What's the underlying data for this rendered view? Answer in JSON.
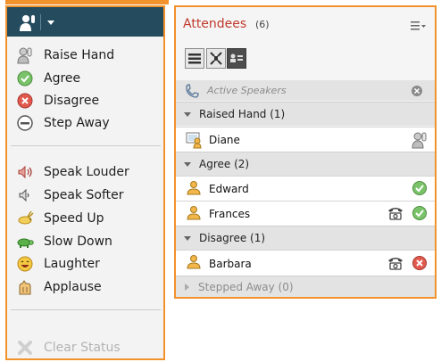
{
  "status_menu": {
    "items": [
      {
        "label": "Raise Hand",
        "icon": "raise-hand-icon"
      },
      {
        "label": "Agree",
        "icon": "agree-check-icon"
      },
      {
        "label": "Disagree",
        "icon": "disagree-x-icon"
      },
      {
        "label": "Step Away",
        "icon": "step-away-icon"
      },
      {
        "label": "Speak Louder",
        "icon": "speaker-loud-icon"
      },
      {
        "label": "Speak Softer",
        "icon": "speaker-soft-icon"
      },
      {
        "label": "Speed Up",
        "icon": "rabbit-icon"
      },
      {
        "label": "Slow Down",
        "icon": "turtle-icon"
      },
      {
        "label": "Laughter",
        "icon": "laugh-face-icon"
      },
      {
        "label": "Applause",
        "icon": "clapping-hands-icon"
      }
    ],
    "clear_label": "Clear Status"
  },
  "attendees": {
    "title": "Attendees",
    "count": "(6)",
    "active_speakers": "Active Speakers",
    "groups": {
      "raised": {
        "label": "Raised Hand (1)",
        "people": [
          "Diane"
        ]
      },
      "agree": {
        "label": "Agree (2)",
        "people": [
          "Edward",
          "Frances"
        ]
      },
      "disagree": {
        "label": "Disagree (1)",
        "people": [
          "Barbara"
        ]
      },
      "away": {
        "label": "Stepped Away (0)"
      }
    }
  },
  "colors": {
    "highlight_border": "#f2922c",
    "header_bg": "#244b5e",
    "title_red": "#c0392b",
    "agree_green": "#5cb85c",
    "disagree_red": "#e05a4e"
  }
}
